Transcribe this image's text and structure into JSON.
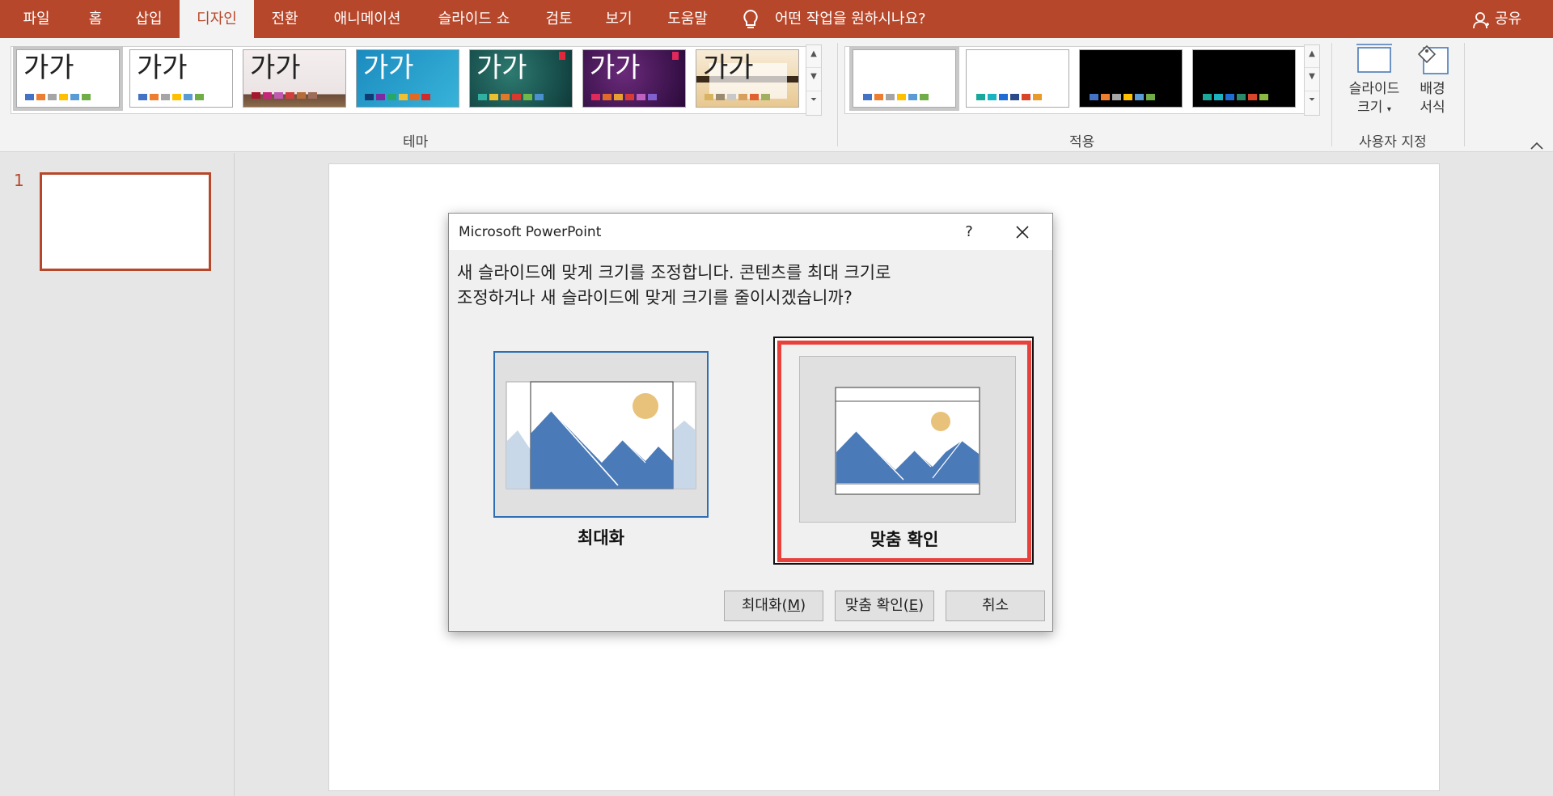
{
  "menu": {
    "tabs": [
      "파일",
      "홈",
      "삽입",
      "디자인",
      "전환",
      "애니메이션",
      "슬라이드 쇼",
      "검토",
      "보기",
      "도움말"
    ],
    "active_tab": "디자인",
    "tell_me": "어떤 작업을 원하시나요?",
    "share": "공유"
  },
  "ribbon": {
    "theme_sample_text": "가가",
    "group_theme": "테마",
    "group_variants": "적용",
    "group_customize": "사용자 지정",
    "slide_size_line1": "슬라이드",
    "slide_size_line2": "크기",
    "bg_format_line1": "배경",
    "bg_format_line2": "서식"
  },
  "thumbnails": {
    "slide_number": "1"
  },
  "dialog": {
    "title": "Microsoft PowerPoint",
    "help": "?",
    "message_line1": "새 슬라이드에 맞게 크기를 조정합니다. 콘텐츠를 최대 크기로",
    "message_line2": "조정하거나 새 슬라이드에 맞게 크기를 줄이시겠습니까?",
    "option_maximize": "최대화",
    "option_fit": "맞춤 확인",
    "btn_maximize": "최대화(",
    "btn_maximize_key": "M",
    "btn_fit": "맞춤 확인(",
    "btn_fit_key": "E",
    "btn_close_paren": ")",
    "btn_cancel": "취소"
  },
  "colors": {
    "brand": "#b7472a",
    "accent_blue": "#2d6eb4",
    "highlight_red": "#e8413c"
  }
}
